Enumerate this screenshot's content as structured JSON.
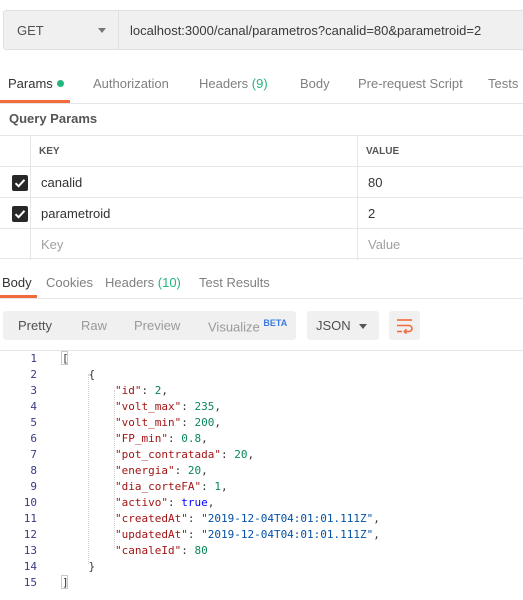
{
  "request": {
    "method": "GET",
    "url": "localhost:3000/canal/parametros?canalid=80&parametroid=2"
  },
  "request_tabs": [
    {
      "label": "Params",
      "active": true
    },
    {
      "label": "Authorization"
    },
    {
      "label": "Headers",
      "count": "(9)"
    },
    {
      "label": "Body"
    },
    {
      "label": "Pre-request Script"
    },
    {
      "label": "Tests"
    }
  ],
  "query_params": {
    "title": "Query Params",
    "headers": {
      "key": "KEY",
      "value": "VALUE"
    },
    "rows": [
      {
        "key": "canalid",
        "value": "80",
        "checked": true
      },
      {
        "key": "parametroid",
        "value": "2",
        "checked": true
      }
    ],
    "placeholder": {
      "key": "Key",
      "value": "Value"
    }
  },
  "response_tabs": [
    {
      "label": "Body",
      "active": true
    },
    {
      "label": "Cookies"
    },
    {
      "label": "Headers",
      "count": "(10)"
    },
    {
      "label": "Test Results"
    }
  ],
  "view_modes": [
    {
      "label": "Pretty",
      "active": true
    },
    {
      "label": "Raw"
    },
    {
      "label": "Preview"
    },
    {
      "label": "Visualize",
      "badge": "BETA"
    }
  ],
  "format": "JSON",
  "icons": {
    "method_dropdown": "chevron-down-icon",
    "wrap": "wrap-lines-icon",
    "checkbox": "checkbox-checked-icon"
  },
  "colors": {
    "accent": "#f26b3a",
    "green": "#26b47f",
    "badge": "#3d7be0"
  },
  "json_lines": [
    {
      "n": "1",
      "tokens": [
        [
          "p",
          "["
        ]
      ]
    },
    {
      "n": "2",
      "tokens": [
        [
          "p",
          "    {"
        ]
      ]
    },
    {
      "n": "3",
      "tokens": [
        [
          "p",
          "        "
        ],
        [
          "k",
          "\"id\""
        ],
        [
          "p",
          ": "
        ],
        [
          "n",
          "2"
        ],
        [
          "p",
          ","
        ]
      ]
    },
    {
      "n": "4",
      "tokens": [
        [
          "p",
          "        "
        ],
        [
          "k",
          "\"volt_max\""
        ],
        [
          "p",
          ": "
        ],
        [
          "n",
          "235"
        ],
        [
          "p",
          ","
        ]
      ]
    },
    {
      "n": "5",
      "tokens": [
        [
          "p",
          "        "
        ],
        [
          "k",
          "\"volt_min\""
        ],
        [
          "p",
          ": "
        ],
        [
          "n",
          "200"
        ],
        [
          "p",
          ","
        ]
      ]
    },
    {
      "n": "6",
      "tokens": [
        [
          "p",
          "        "
        ],
        [
          "k",
          "\"FP_min\""
        ],
        [
          "p",
          ": "
        ],
        [
          "n",
          "0.8"
        ],
        [
          "p",
          ","
        ]
      ]
    },
    {
      "n": "7",
      "tokens": [
        [
          "p",
          "        "
        ],
        [
          "k",
          "\"pot_contratada\""
        ],
        [
          "p",
          ": "
        ],
        [
          "n",
          "20"
        ],
        [
          "p",
          ","
        ]
      ]
    },
    {
      "n": "8",
      "tokens": [
        [
          "p",
          "        "
        ],
        [
          "k",
          "\"energia\""
        ],
        [
          "p",
          ": "
        ],
        [
          "n",
          "20"
        ],
        [
          "p",
          ","
        ]
      ]
    },
    {
      "n": "9",
      "tokens": [
        [
          "p",
          "        "
        ],
        [
          "k",
          "\"dia_corteFA\""
        ],
        [
          "p",
          ": "
        ],
        [
          "n",
          "1"
        ],
        [
          "p",
          ","
        ]
      ]
    },
    {
      "n": "10",
      "tokens": [
        [
          "p",
          "        "
        ],
        [
          "k",
          "\"activo\""
        ],
        [
          "p",
          ": "
        ],
        [
          "b",
          "true"
        ],
        [
          "p",
          ","
        ]
      ]
    },
    {
      "n": "11",
      "tokens": [
        [
          "p",
          "        "
        ],
        [
          "k",
          "\"createdAt\""
        ],
        [
          "p",
          ": "
        ],
        [
          "s",
          "\"2019-12-04T04:01:01.111Z\""
        ],
        [
          "p",
          ","
        ]
      ]
    },
    {
      "n": "12",
      "tokens": [
        [
          "p",
          "        "
        ],
        [
          "k",
          "\"updatedAt\""
        ],
        [
          "p",
          ": "
        ],
        [
          "s",
          "\"2019-12-04T04:01:01.111Z\""
        ],
        [
          "p",
          ","
        ]
      ]
    },
    {
      "n": "13",
      "tokens": [
        [
          "p",
          "        "
        ],
        [
          "k",
          "\"canaleId\""
        ],
        [
          "p",
          ": "
        ],
        [
          "n",
          "80"
        ]
      ]
    },
    {
      "n": "14",
      "tokens": [
        [
          "p",
          "    }"
        ]
      ]
    },
    {
      "n": "15",
      "tokens": [
        [
          "p",
          "]"
        ]
      ]
    }
  ]
}
